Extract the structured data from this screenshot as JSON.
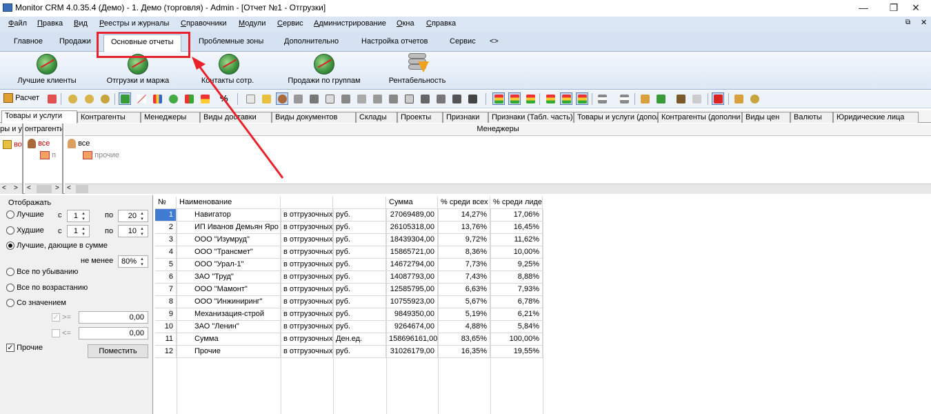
{
  "window": {
    "title": "Monitor CRM 4.0.35.4 (Демо) - 1. Демо (торговля) - Admin - [Отчет №1 - Отгрузки]",
    "min": "—",
    "max": "❐",
    "close": "✕"
  },
  "menu": [
    "Файл",
    "Правка",
    "Вид",
    "Реестры и журналы",
    "Справочники",
    "Модули",
    "Сервис",
    "Администрирование",
    "Окна",
    "Справка"
  ],
  "ribbon_tabs": [
    "Главное",
    "Продажи",
    "Основные отчеты",
    "Проблемные зоны",
    "Дополнительно",
    "Настройка отчетов",
    "Сервис",
    "<>"
  ],
  "ribbon_buttons": [
    "Лучшие клиенты",
    "Отгрузки и маржа",
    "Контакты сотр.",
    "Продажи по группам",
    "Рентабельность"
  ],
  "toolbar": {
    "calc_label": "Расчет"
  },
  "dimension_tabs": [
    "Товары и услуги",
    "Контрагенты",
    "Менеджеры",
    "Виды доставки",
    "Виды документов",
    "Склады",
    "Проекты",
    "Признаки",
    "Признаки (Табл. часть)",
    "Товары и услуги (допол",
    "Контрагенты (дополни",
    "Виды цен",
    "Валюты",
    "Юридические лица"
  ],
  "dim_panels": {
    "goods": {
      "header": "ры и у",
      "root": "во"
    },
    "contractors": {
      "header": "онтрагенти",
      "root": "все",
      "child": "п"
    },
    "managers": {
      "header": "Менеджеры",
      "root": "все",
      "child": "прочие"
    }
  },
  "settings": {
    "title": "Отображать",
    "best_label": "Лучшие",
    "best_from_label": "с",
    "best_from": "1",
    "best_to_label": "по",
    "best_to": "20",
    "worst_label": "Худшие",
    "worst_from_label": "с",
    "worst_from": "1",
    "worst_to_label": "по",
    "worst_to": "10",
    "best_sum_label": "Лучшие, дающие в сумме",
    "min_label": "не менее",
    "min_value": "80%",
    "desc_label": "Все по убыванию",
    "asc_label": "Все по возрастанию",
    "value_label": "Со значением",
    "ge_label": ">=",
    "ge_value": "0,00",
    "le_label": "<=",
    "le_value": "0,00",
    "other_label": "Прочие",
    "place_button": "Поместить"
  },
  "grid": {
    "headers": [
      "№",
      "Наименование",
      "",
      "",
      "Сумма",
      "% среди всех",
      "% среди лиде"
    ],
    "rows": [
      [
        "1",
        "Навигатор",
        "в отгрузочных",
        "руб.",
        "27069489,00",
        "14,27%",
        "17,06%"
      ],
      [
        "2",
        "ИП Иванов Демьян Яро",
        "в отгрузочных",
        "руб.",
        "26105318,00",
        "13,76%",
        "16,45%"
      ],
      [
        "3",
        "ООО \"Изумруд\"",
        "в отгрузочных",
        "руб.",
        "18439304,00",
        "9,72%",
        "11,62%"
      ],
      [
        "4",
        "ООО \"Трансмет\"",
        "в отгрузочных",
        "руб.",
        "15865721,00",
        "8,36%",
        "10,00%"
      ],
      [
        "5",
        "ООО \"Урал-1\"",
        "в отгрузочных",
        "руб.",
        "14672794,00",
        "7,73%",
        "9,25%"
      ],
      [
        "6",
        "ЗАО \"Труд\"",
        "в отгрузочных",
        "руб.",
        "14087793,00",
        "7,43%",
        "8,88%"
      ],
      [
        "7",
        "ООО \"Мамонт\"",
        "в отгрузочных",
        "руб.",
        "12585795,00",
        "6,63%",
        "7,93%"
      ],
      [
        "8",
        "ООО \"Инжиниринг\"",
        "в отгрузочных",
        "руб.",
        "10755923,00",
        "5,67%",
        "6,78%"
      ],
      [
        "9",
        "Механизация-строй",
        "в отгрузочных",
        "руб.",
        "9849350,00",
        "5,19%",
        "6,21%"
      ],
      [
        "10",
        "ЗАО \"Ленин\"",
        "в отгрузочных",
        "руб.",
        "9264674,00",
        "4,88%",
        "5,84%"
      ],
      [
        "11",
        "Сумма",
        "в отгрузочных",
        "Ден.ед.",
        "158696161,00",
        "83,65%",
        "100,00%"
      ],
      [
        "12",
        "Прочие",
        "в отгрузочных",
        "руб.",
        "31026179,00",
        "16,35%",
        "19,55%"
      ]
    ]
  },
  "colors": {
    "annotation": "#e8212a",
    "selection": "#3e7bd1",
    "ribbon": "#d5e2f2"
  }
}
